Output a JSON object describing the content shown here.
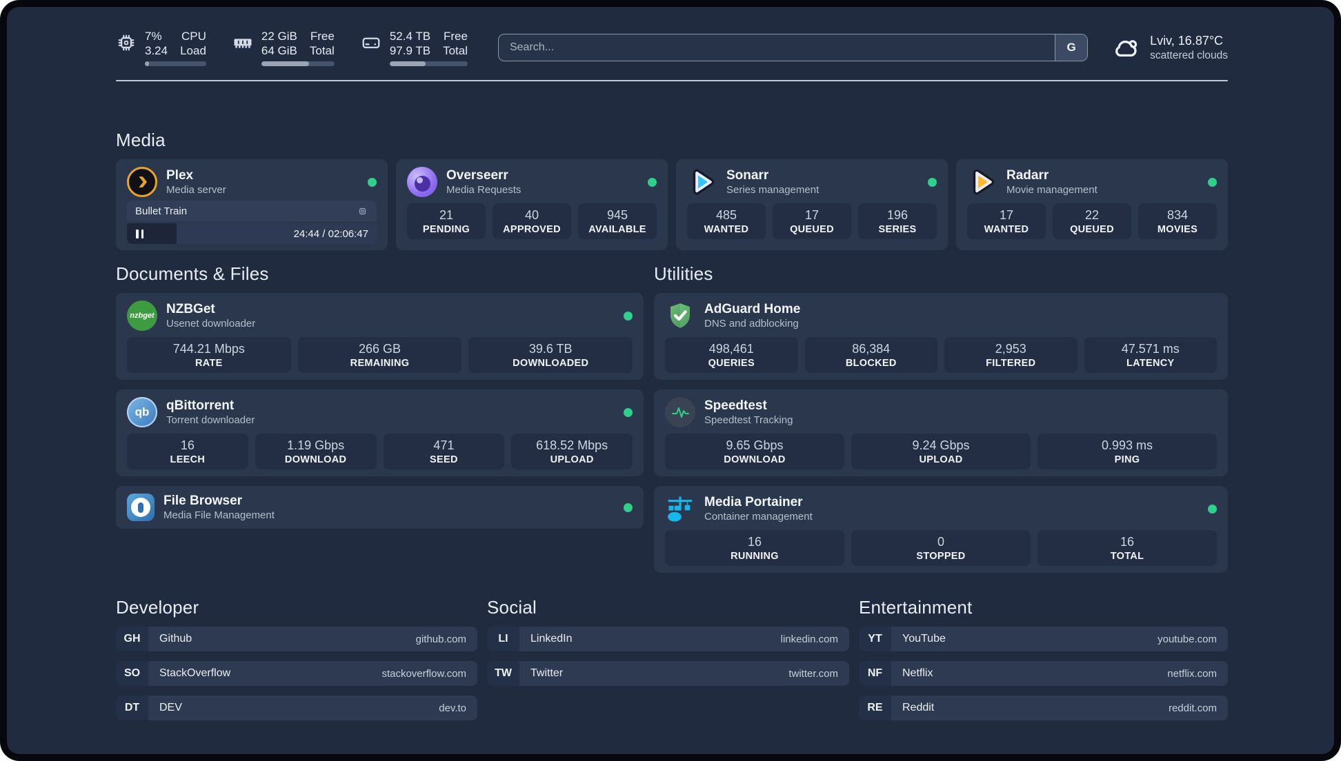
{
  "topbar": {
    "cpu": {
      "values": [
        "7%",
        "3.24"
      ],
      "labels": [
        "CPU",
        "Load"
      ],
      "progress_pct": 7
    },
    "memory": {
      "values": [
        "22 GiB",
        "64 GiB"
      ],
      "labels": [
        "Free",
        "Total"
      ],
      "progress_pct": 65
    },
    "disk": {
      "values": [
        "52.4 TB",
        "97.9 TB"
      ],
      "labels": [
        "Free",
        "Total"
      ],
      "progress_pct": 46
    },
    "search_placeholder": "Search...",
    "search_engine_button": "G",
    "weather_line1": "Lviv, 16.87°C",
    "weather_line2": "scattered clouds"
  },
  "sections": {
    "media": "Media",
    "documents": "Documents & Files",
    "utilities": "Utilities"
  },
  "apps": {
    "plex": {
      "name": "Plex",
      "desc": "Media server",
      "status": "online",
      "now_playing": {
        "title": "Bullet Train",
        "time_display": "24:44 / 02:06:47",
        "progress_pct": 20
      }
    },
    "overseerr": {
      "name": "Overseerr",
      "desc": "Media Requests",
      "status": "online",
      "stats": [
        {
          "value": "21",
          "label": "PENDING"
        },
        {
          "value": "40",
          "label": "APPROVED"
        },
        {
          "value": "945",
          "label": "AVAILABLE"
        }
      ]
    },
    "sonarr": {
      "name": "Sonarr",
      "desc": "Series management",
      "status": "online",
      "stats": [
        {
          "value": "485",
          "label": "WANTED"
        },
        {
          "value": "17",
          "label": "QUEUED"
        },
        {
          "value": "196",
          "label": "SERIES"
        }
      ]
    },
    "radarr": {
      "name": "Radarr",
      "desc": "Movie management",
      "status": "online",
      "stats": [
        {
          "value": "17",
          "label": "WANTED"
        },
        {
          "value": "22",
          "label": "QUEUED"
        },
        {
          "value": "834",
          "label": "MOVIES"
        }
      ]
    },
    "nzbget": {
      "name": "NZBGet",
      "desc": "Usenet downloader",
      "status": "online",
      "icon_text": "nzbget",
      "stats": [
        {
          "value": "744.21 Mbps",
          "label": "RATE"
        },
        {
          "value": "266 GB",
          "label": "REMAINING"
        },
        {
          "value": "39.6 TB",
          "label": "DOWNLOADED"
        }
      ]
    },
    "qbittorrent": {
      "name": "qBittorrent",
      "desc": "Torrent downloader",
      "status": "online",
      "icon_text": "qb",
      "stats": [
        {
          "value": "16",
          "label": "LEECH"
        },
        {
          "value": "1.19 Gbps",
          "label": "DOWNLOAD"
        },
        {
          "value": "471",
          "label": "SEED"
        },
        {
          "value": "618.52 Mbps",
          "label": "UPLOAD"
        }
      ]
    },
    "filebrowser": {
      "name": "File Browser",
      "desc": "Media File Management",
      "status": "online"
    },
    "adguard": {
      "name": "AdGuard Home",
      "desc": "DNS and adblocking",
      "stats": [
        {
          "value": "498,461",
          "label": "QUERIES"
        },
        {
          "value": "86,384",
          "label": "BLOCKED"
        },
        {
          "value": "2,953",
          "label": "FILTERED"
        },
        {
          "value": "47.571 ms",
          "label": "LATENCY"
        }
      ]
    },
    "speedtest": {
      "name": "Speedtest",
      "desc": "Speedtest Tracking",
      "stats": [
        {
          "value": "9.65 Gbps",
          "label": "DOWNLOAD"
        },
        {
          "value": "9.24 Gbps",
          "label": "UPLOAD"
        },
        {
          "value": "0.993 ms",
          "label": "PING"
        }
      ]
    },
    "portainer": {
      "name": "Media Portainer",
      "desc": "Container management",
      "status": "online",
      "stats": [
        {
          "value": "16",
          "label": "RUNNING"
        },
        {
          "value": "0",
          "label": "STOPPED"
        },
        {
          "value": "16",
          "label": "TOTAL"
        }
      ]
    }
  },
  "link_sections": [
    {
      "title": "Developer",
      "links": [
        {
          "tag": "GH",
          "name": "Github",
          "url": "github.com"
        },
        {
          "tag": "SO",
          "name": "StackOverflow",
          "url": "stackoverflow.com"
        },
        {
          "tag": "DT",
          "name": "DEV",
          "url": "dev.to"
        }
      ]
    },
    {
      "title": "Social",
      "links": [
        {
          "tag": "LI",
          "name": "LinkedIn",
          "url": "linkedin.com"
        },
        {
          "tag": "TW",
          "name": "Twitter",
          "url": "twitter.com"
        }
      ]
    },
    {
      "title": "Entertainment",
      "links": [
        {
          "tag": "YT",
          "name": "YouTube",
          "url": "youtube.com"
        },
        {
          "tag": "NF",
          "name": "Netflix",
          "url": "netflix.com"
        },
        {
          "tag": "RE",
          "name": "Reddit",
          "url": "reddit.com"
        }
      ]
    }
  ],
  "icons": {
    "cpu": "chip",
    "memory": "ram-stick",
    "disk": "hard-drive",
    "weather": "cloud",
    "pause": "pause-bars",
    "transcode": "chip-small"
  },
  "colors": {
    "status_online": "#2fd08c",
    "accent_plex": "#e9a42c",
    "accent_overseerr": "#8b5cf6",
    "accent_sonarr": "#35c5f4",
    "accent_radarr": "#ffb92e",
    "accent_nzbget": "#3d9c40",
    "accent_qbittorrent": "#3a7cc4",
    "accent_adguard": "#67c475",
    "accent_speedtest": "#2fd08c",
    "accent_filebrowser": "#4a9fd8",
    "accent_portainer": "#16b8ec"
  }
}
